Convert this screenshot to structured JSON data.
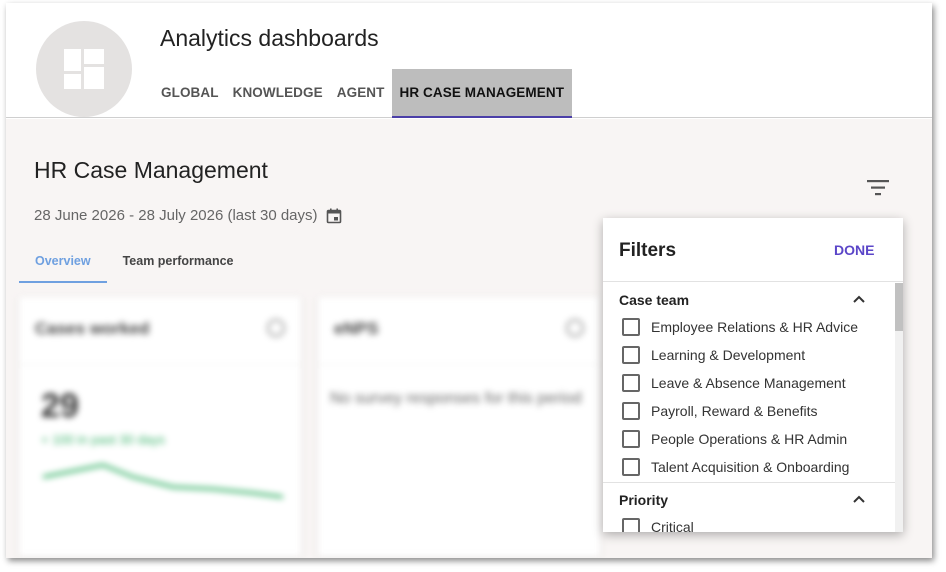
{
  "header": {
    "app_title": "Analytics dashboards",
    "tabs": [
      {
        "label": "GLOBAL"
      },
      {
        "label": "KNOWLEDGE"
      },
      {
        "label": "AGENT"
      },
      {
        "label": "HR CASE MANAGEMENT",
        "active": true
      }
    ]
  },
  "page": {
    "title": "HR Case Management",
    "date_range": "28 June 2026 - 28 July 2026 (last 30 days)",
    "sub_tabs": [
      {
        "label": "Overview",
        "active": true
      },
      {
        "label": "Team performance"
      }
    ]
  },
  "cards": [
    {
      "title": "Cases worked",
      "value": "29",
      "trend": "+ 100 in past 30 days"
    },
    {
      "title": "eNPS",
      "message": "No survey responses for this period"
    }
  ],
  "filters": {
    "title": "Filters",
    "done_label": "DONE",
    "sections": [
      {
        "title": "Case team",
        "options": [
          "Employee Relations & HR Advice",
          "Learning & Development",
          "Leave & Absence Management",
          "Payroll, Reward & Benefits",
          "People Operations & HR Admin",
          "Talent Acquisition & Onboarding"
        ]
      },
      {
        "title": "Priority",
        "options": [
          "Critical"
        ]
      }
    ]
  },
  "colors": {
    "accent": "#5b46c8",
    "active_tab_bg": "#bdbdbd",
    "subtab_active": "#6fa0e0",
    "content_bg": "#f8f5f4",
    "trend_green": "#3bb36b"
  },
  "icons": {
    "avatar": "dashboard-icon",
    "date": "calendar-icon",
    "filter": "filter-icon",
    "section_toggle": "chevron-up-icon"
  }
}
